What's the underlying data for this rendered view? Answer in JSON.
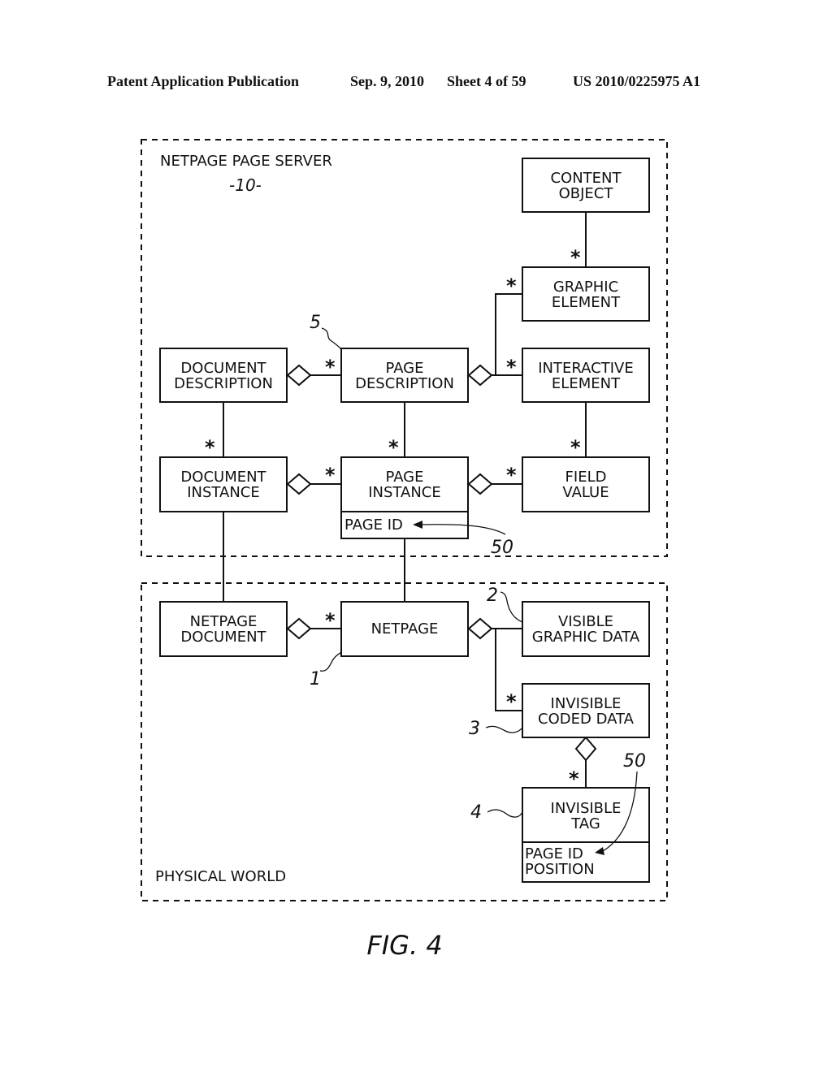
{
  "header": {
    "publication": "Patent Application Publication",
    "date": "Sep. 9, 2010",
    "sheet": "Sheet 4 of 59",
    "number": "US 2010/0225975 A1"
  },
  "regions": {
    "server": {
      "title": "NETPAGE PAGE SERVER",
      "ref": "-10-"
    },
    "physical": {
      "title": "PHYSICAL WORLD"
    }
  },
  "boxes": {
    "content_object": [
      "CONTENT",
      "OBJECT"
    ],
    "graphic_element": [
      "GRAPHIC",
      "ELEMENT"
    ],
    "interactive_element": [
      "INTERACTIVE",
      "ELEMENT"
    ],
    "document_description": [
      "DOCUMENT",
      "DESCRIPTION"
    ],
    "page_description": [
      "PAGE",
      "DESCRIPTION"
    ],
    "document_instance": [
      "DOCUMENT",
      "INSTANCE"
    ],
    "page_instance": [
      "PAGE",
      "INSTANCE"
    ],
    "page_instance_attrs": [
      "PAGE ID"
    ],
    "field_value": [
      "FIELD",
      "VALUE"
    ],
    "netpage_document": [
      "NETPAGE",
      "DOCUMENT"
    ],
    "netpage": [
      "NETPAGE"
    ],
    "visible_graphic_data": [
      "VISIBLE",
      "GRAPHIC DATA"
    ],
    "invisible_coded_data": [
      "INVISIBLE",
      "CODED DATA"
    ],
    "invisible_tag": [
      "INVISIBLE",
      "TAG"
    ],
    "invisible_tag_attrs": [
      "PAGE ID",
      "POSITION"
    ]
  },
  "multiplicity": "*",
  "refs": {
    "page_description": "5",
    "page_id_server": "50",
    "netpage": "1",
    "visible_graphic_data": "2",
    "invisible_coded_data": "3",
    "invisible_tag": "4",
    "page_id_tag": "50"
  },
  "figure_caption": "FIG. 4"
}
